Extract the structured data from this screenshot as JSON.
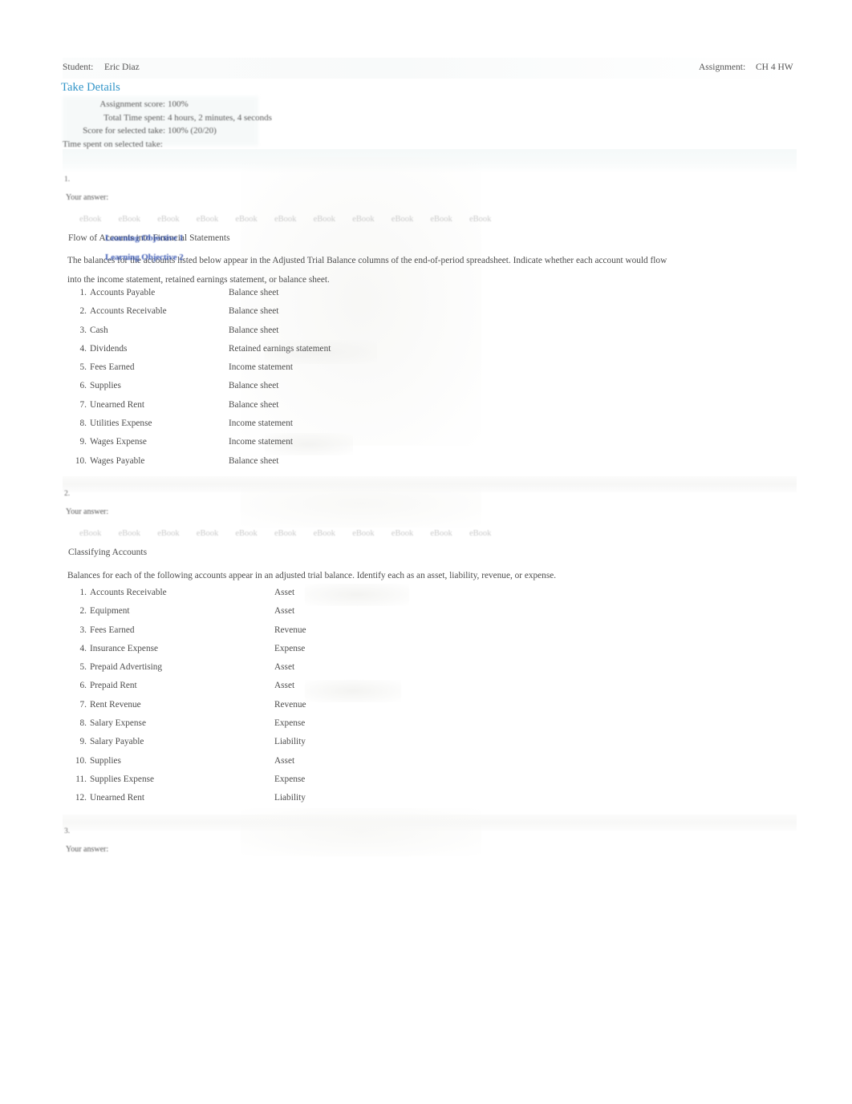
{
  "header": {
    "student_label": "Student:",
    "student_name": "Eric Diaz",
    "assignment_label": "Assignment:",
    "assignment_name": "CH 4 HW"
  },
  "take_details": {
    "heading": "Take Details",
    "rows": [
      {
        "label": "Assignment score:",
        "value": "100%"
      },
      {
        "label": "Total Time spent:",
        "value": "4 hours, 2 minutes, 4 seconds"
      },
      {
        "label": "Score for selected take:",
        "value": "100% (20/20)"
      },
      {
        "label": "Time spent on selected take:",
        "value": ""
      }
    ]
  },
  "common": {
    "your_answer_label": "Your answer:",
    "ebook_label": "eBook"
  },
  "questions": [
    {
      "number": "1.",
      "title": "Flow of Accounts into Financial Statements",
      "description": "The balances for the accounts listed below appear in the Adjusted Trial Balance columns of the end-of-period spreadsheet. Indicate whether each account would flow into the income statement, retained earnings statement, or balance sheet.",
      "ebook_count": 11,
      "overlays": [
        {
          "text": "Learning Objective 1"
        },
        {
          "text": "Learning Objective 2"
        }
      ],
      "items": [
        {
          "n": "1.",
          "name": "Accounts Payable",
          "value": "Balance sheet"
        },
        {
          "n": "2.",
          "name": "Accounts Receivable",
          "value": "Balance sheet"
        },
        {
          "n": "3.",
          "name": "Cash",
          "value": "Balance sheet"
        },
        {
          "n": "4.",
          "name": "Dividends",
          "value": "Retained earnings statement"
        },
        {
          "n": "5.",
          "name": "Fees Earned",
          "value": "Income statement"
        },
        {
          "n": "6.",
          "name": "Supplies",
          "value": "Balance sheet"
        },
        {
          "n": "7.",
          "name": "Unearned Rent",
          "value": "Balance sheet"
        },
        {
          "n": "8.",
          "name": "Utilities Expense",
          "value": "Income statement"
        },
        {
          "n": "9.",
          "name": "Wages Expense",
          "value": "Income statement"
        },
        {
          "n": "10.",
          "name": "Wages Payable",
          "value": "Balance sheet"
        }
      ]
    },
    {
      "number": "2.",
      "title": "Classifying Accounts",
      "description": "Balances for each of the following accounts appear in an adjusted trial balance. Identify each as an asset, liability, revenue, or expense.",
      "ebook_count": 11,
      "overlays": [],
      "items": [
        {
          "n": "1.",
          "name": "Accounts Receivable",
          "value": "Asset"
        },
        {
          "n": "2.",
          "name": "Equipment",
          "value": "Asset"
        },
        {
          "n": "3.",
          "name": "Fees Earned",
          "value": "Revenue"
        },
        {
          "n": "4.",
          "name": "Insurance Expense",
          "value": "Expense"
        },
        {
          "n": "5.",
          "name": "Prepaid Advertising",
          "value": "Asset"
        },
        {
          "n": "6.",
          "name": "Prepaid Rent",
          "value": "Asset"
        },
        {
          "n": "7.",
          "name": "Rent Revenue",
          "value": "Revenue"
        },
        {
          "n": "8.",
          "name": "Salary Expense",
          "value": "Expense"
        },
        {
          "n": "9.",
          "name": "Salary Payable",
          "value": "Liability"
        },
        {
          "n": "10.",
          "name": "Supplies",
          "value": "Asset"
        },
        {
          "n": "11.",
          "name": "Supplies Expense",
          "value": "Expense"
        },
        {
          "n": "12.",
          "name": "Unearned Rent",
          "value": "Liability"
        }
      ]
    },
    {
      "number": "3.",
      "title": "",
      "description": "",
      "ebook_count": 0,
      "overlays": [],
      "items": []
    }
  ],
  "colors": {
    "heading_blue": "#3094c8",
    "overlay_blue": "#2f4fb0",
    "body_gray": "#4d4d4d",
    "ebook_gray": "#c9c9c9"
  }
}
